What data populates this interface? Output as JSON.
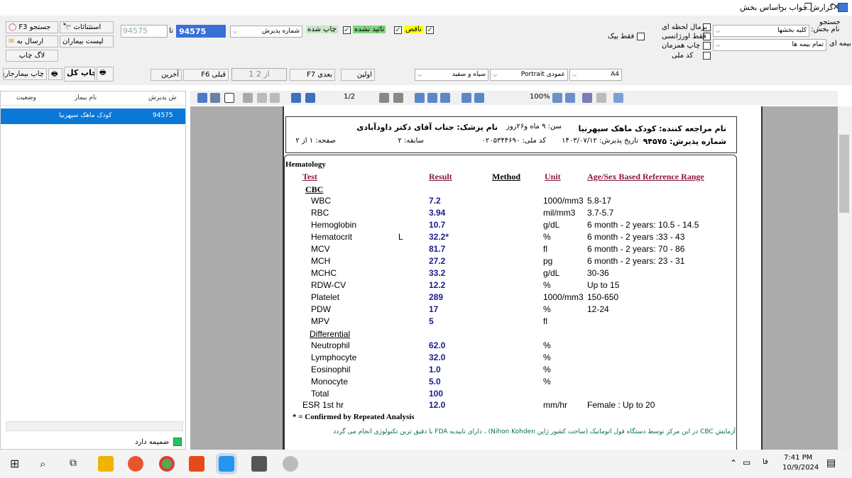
{
  "window": {
    "title": "گزارش جواب براساس بخش",
    "min": "–",
    "max": "❐",
    "close": "✕"
  },
  "toolbar": {
    "search_label": "جستجو",
    "section_name_label": "نام بخش:",
    "section_value": "کلیه بخشها",
    "insurance_label": "بیمه ای",
    "insurance_value": "تمام بیمه ها",
    "opt_pr": "برمال لحظه ای",
    "opt_urgent": "فقط اورژانسی",
    "opt_print_along": "چاپ همزمان",
    "opt_national": "کد ملی",
    "opt_only_bank": "فقط بیک",
    "incomplete": "ناقص",
    "not_approved": "تائید نشده",
    "printed": "چاپ شده",
    "reception_combo": "شماره پذیرش",
    "to_label": "تا",
    "from_value": "94575",
    "to_value": "94575",
    "f3_search": "F3 جستجو",
    "exceptions": "استثنائات",
    "patient_list": "لیست بیماران",
    "send_to": "ارسال به",
    "print_log": "لاگ چاپ",
    "print_all": "چاپ کل",
    "print_hosp": "چاپ بیمارجاری",
    "last": "آخرین",
    "prev": "قبلی F6",
    "page_of": "1 از 2",
    "next": "بعدی F7",
    "first": "اولین",
    "color_mode": "سیاه و سفید",
    "orientation": "Portrait عمودی",
    "paper": "A4"
  },
  "left": {
    "col_reception": "ش پذیرش",
    "col_patient": "نام بیمار",
    "col_status": "وضعیت",
    "row_reception": "94575",
    "row_patient": "کودک ماهک سپهرنیا",
    "attach_label": "ضمیمه دارد"
  },
  "viewer": {
    "page_indicator": "1/2",
    "zoom": "100%"
  },
  "report": {
    "patient_line": "نام مراجعه کننده:  کودک ماهک سپهرنیا",
    "age_line": "سن: ۹ ماه و۲۶روز",
    "doctor_line": "نام پزشک: جناب آقای دکتر  داودآبادی",
    "reception_line": "شماره پذیرش:  ۹۴۵۷۵",
    "date_line": "تاریخ پذیرش: ۱۴۰۳/۰۷/۱۲",
    "national_line": "کد ملی: ۰۲۰۵۳۴۴۶۹۰",
    "history_line": "سابقه: ۲",
    "page_line": "صفحه: ۱  از  ۲",
    "section": "Hematology",
    "h_test": "Test",
    "h_result": "Result",
    "h_method": "Method",
    "h_unit": "Unit",
    "h_range": "Age/Sex Based Reference Range",
    "group_cbc": "CBC",
    "group_diff": "Differential",
    "rows": [
      {
        "test": "WBC",
        "flag": "",
        "result": "7.2",
        "unit": "1000/mm3",
        "range": "5.8-17"
      },
      {
        "test": "RBC",
        "flag": "",
        "result": "3.94",
        "unit": "mil/mm3",
        "range": "3.7-5.7"
      },
      {
        "test": "Hemoglobin",
        "flag": "",
        "result": "10.7",
        "unit": "g/dL",
        "range": "6 month - 2 years: 10.5 - 14.5"
      },
      {
        "test": "Hematocrit",
        "flag": "L",
        "result": "32.2*",
        "unit": "%",
        "range": "6 month - 2 years :33 - 43"
      },
      {
        "test": "MCV",
        "flag": "",
        "result": "81.7",
        "unit": "fl",
        "range": "6 month - 2 years: 70 - 86"
      },
      {
        "test": "MCH",
        "flag": "",
        "result": "27.2",
        "unit": "pg",
        "range": "6 month - 2 years: 23 - 31"
      },
      {
        "test": "MCHC",
        "flag": "",
        "result": "33.2",
        "unit": "g/dL",
        "range": "30-36"
      },
      {
        "test": "RDW-CV",
        "flag": "",
        "result": "12.2",
        "unit": "%",
        "range": "Up to 15"
      },
      {
        "test": "Platelet",
        "flag": "",
        "result": "289",
        "unit": "1000/mm3",
        "range": "150-650"
      },
      {
        "test": "PDW",
        "flag": "",
        "result": "17",
        "unit": "%",
        "range": "12-24"
      },
      {
        "test": "MPV",
        "flag": "",
        "result": "5",
        "unit": "fl",
        "range": ""
      }
    ],
    "diff_rows": [
      {
        "test": "Neutrophil",
        "result": "62.0",
        "unit": "%"
      },
      {
        "test": "Lymphocyte",
        "result": "32.0",
        "unit": "%"
      },
      {
        "test": "Eosinophil",
        "result": "1.0",
        "unit": "%"
      },
      {
        "test": "Monocyte",
        "result": "5.0",
        "unit": "%"
      },
      {
        "test": "Total",
        "result": "100",
        "unit": ""
      }
    ],
    "esr_test": "ESR 1st hr",
    "esr_result": "12.0",
    "esr_unit": "mm/hr",
    "esr_range": "Female : Up to 20",
    "footnote": "* = Confirmed by Repeated Analysis",
    "footer_note": "آزمایش CBC در این مرکز توسط دستگاه فول اتوماتیک (ساخت کشور ژاپن Nihon Kohden) ، دارای تاییدیه FDA با دقیق ترین تکنولوژی انجام می گردد"
  },
  "taskbar": {
    "time": "7:41 PM",
    "date": "10/9/2024",
    "lang": "فا"
  }
}
